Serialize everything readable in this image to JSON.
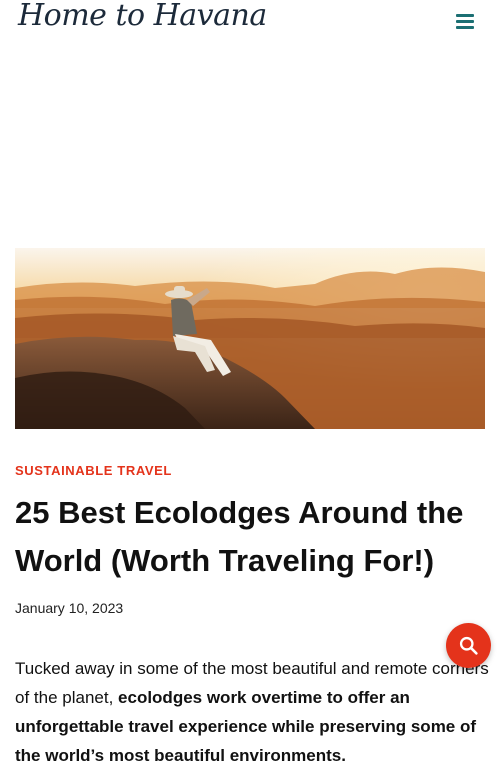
{
  "site": {
    "logo_text": "Home to Havana"
  },
  "header": {
    "menu_icon": "hamburger-menu-icon"
  },
  "article": {
    "category": "SUSTAINABLE TRAVEL",
    "title": "25 Best Ecolodges Around the World (Worth Traveling For!)",
    "date": "January 10, 2023",
    "intro_plain": "Tucked away in some of the most beautiful and remote corners of the planet, ",
    "intro_bold": "ecolodges work overtime to offer an unforgettable travel experience while preserving some of the world’s most beautiful environments."
  },
  "floating": {
    "search_icon": "search-icon"
  },
  "colors": {
    "accent": "#e4331b",
    "menu": "#1b6f73",
    "logo": "#1c2a3a"
  }
}
